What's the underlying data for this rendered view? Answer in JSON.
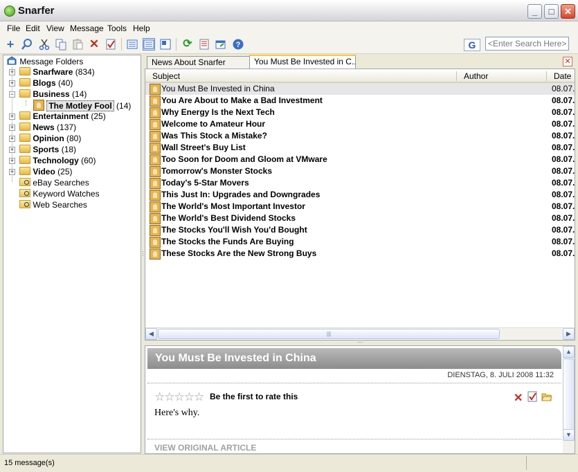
{
  "window": {
    "title": "Snarfer",
    "minimize_glyph": "_",
    "maximize_glyph": "□",
    "close_glyph": "✕"
  },
  "menu": [
    "File",
    "Edit",
    "View",
    "Message",
    "Tools",
    "Help"
  ],
  "toolbar": {
    "icons": [
      "add-icon",
      "find-icon",
      "cut-icon",
      "copy-icon",
      "paste-icon",
      "delete-icon",
      "check-icon",
      "list-view-icon",
      "split-view-icon",
      "reading-view-icon",
      "refresh-icon",
      "checklist-icon",
      "export-icon",
      "help-icon"
    ],
    "search_engine_glyph": "G",
    "search_placeholder": "<Enter Search Here>"
  },
  "folders": {
    "root": "Message Folders",
    "items": [
      {
        "label": "Snarfware",
        "count": "(834)"
      },
      {
        "label": "Blogs",
        "count": "(40)"
      },
      {
        "label": "Business",
        "count": "(14)"
      },
      {
        "label": "The Motley Fool",
        "count": "(14)"
      },
      {
        "label": "Entertainment",
        "count": "(25)"
      },
      {
        "label": "News",
        "count": "(137)"
      },
      {
        "label": "Opinion",
        "count": "(80)"
      },
      {
        "label": "Sports",
        "count": "(18)"
      },
      {
        "label": "Technology",
        "count": "(60)"
      },
      {
        "label": "Video",
        "count": "(25)"
      }
    ],
    "searches": [
      "eBay Searches",
      "Keyword Watches",
      "Web Searches"
    ]
  },
  "tabs": [
    {
      "label": "News About Snarfer"
    },
    {
      "label": "You Must Be Invested in C..."
    }
  ],
  "tab_close_glyph": "✕",
  "columns": {
    "subject": "Subject",
    "author": "Author",
    "date": "Date"
  },
  "messages": [
    {
      "subject": "You Must Be Invested in China",
      "date": "08.07."
    },
    {
      "subject": "You Are About to Make a Bad Investment",
      "date": "08.07."
    },
    {
      "subject": "Why Energy Is the Next Tech",
      "date": "08.07."
    },
    {
      "subject": "Welcome to Amateur Hour",
      "date": "08.07."
    },
    {
      "subject": "Was This Stock a Mistake?",
      "date": "08.07."
    },
    {
      "subject": "Wall Street's Buy List",
      "date": "08.07."
    },
    {
      "subject": "Too Soon for Doom and Gloom at VMware",
      "date": "08.07."
    },
    {
      "subject": "Tomorrow's Monster Stocks",
      "date": "08.07."
    },
    {
      "subject": "Today's 5-Star Movers",
      "date": "08.07."
    },
    {
      "subject": "This Just In: Upgrades and Downgrades",
      "date": "08.07."
    },
    {
      "subject": "The World's Most Important Investor",
      "date": "08.07."
    },
    {
      "subject": "The World's Best Dividend Stocks",
      "date": "08.07."
    },
    {
      "subject": "The Stocks You'll Wish You'd Bought",
      "date": "08.07."
    },
    {
      "subject": "The Stocks the Funds Are Buying",
      "date": "08.07."
    },
    {
      "subject": "These Stocks Are the New Strong Buys",
      "date": "08.07."
    }
  ],
  "preview": {
    "title": "You Must Be Invested in China",
    "date": "DIENSTAG, 8. JULI 2008  11:32",
    "stars": "☆☆☆☆☆",
    "rate_text": "Be the first to rate this",
    "body": "Here's why.",
    "view_original": "VIEW ORIGINAL ARTICLE"
  },
  "status": {
    "text": "15 message(s)"
  },
  "colors": {
    "accent_tab": "#ffc83c",
    "preview_header": "#9e9e9e",
    "delete_red": "#c42b1b"
  }
}
